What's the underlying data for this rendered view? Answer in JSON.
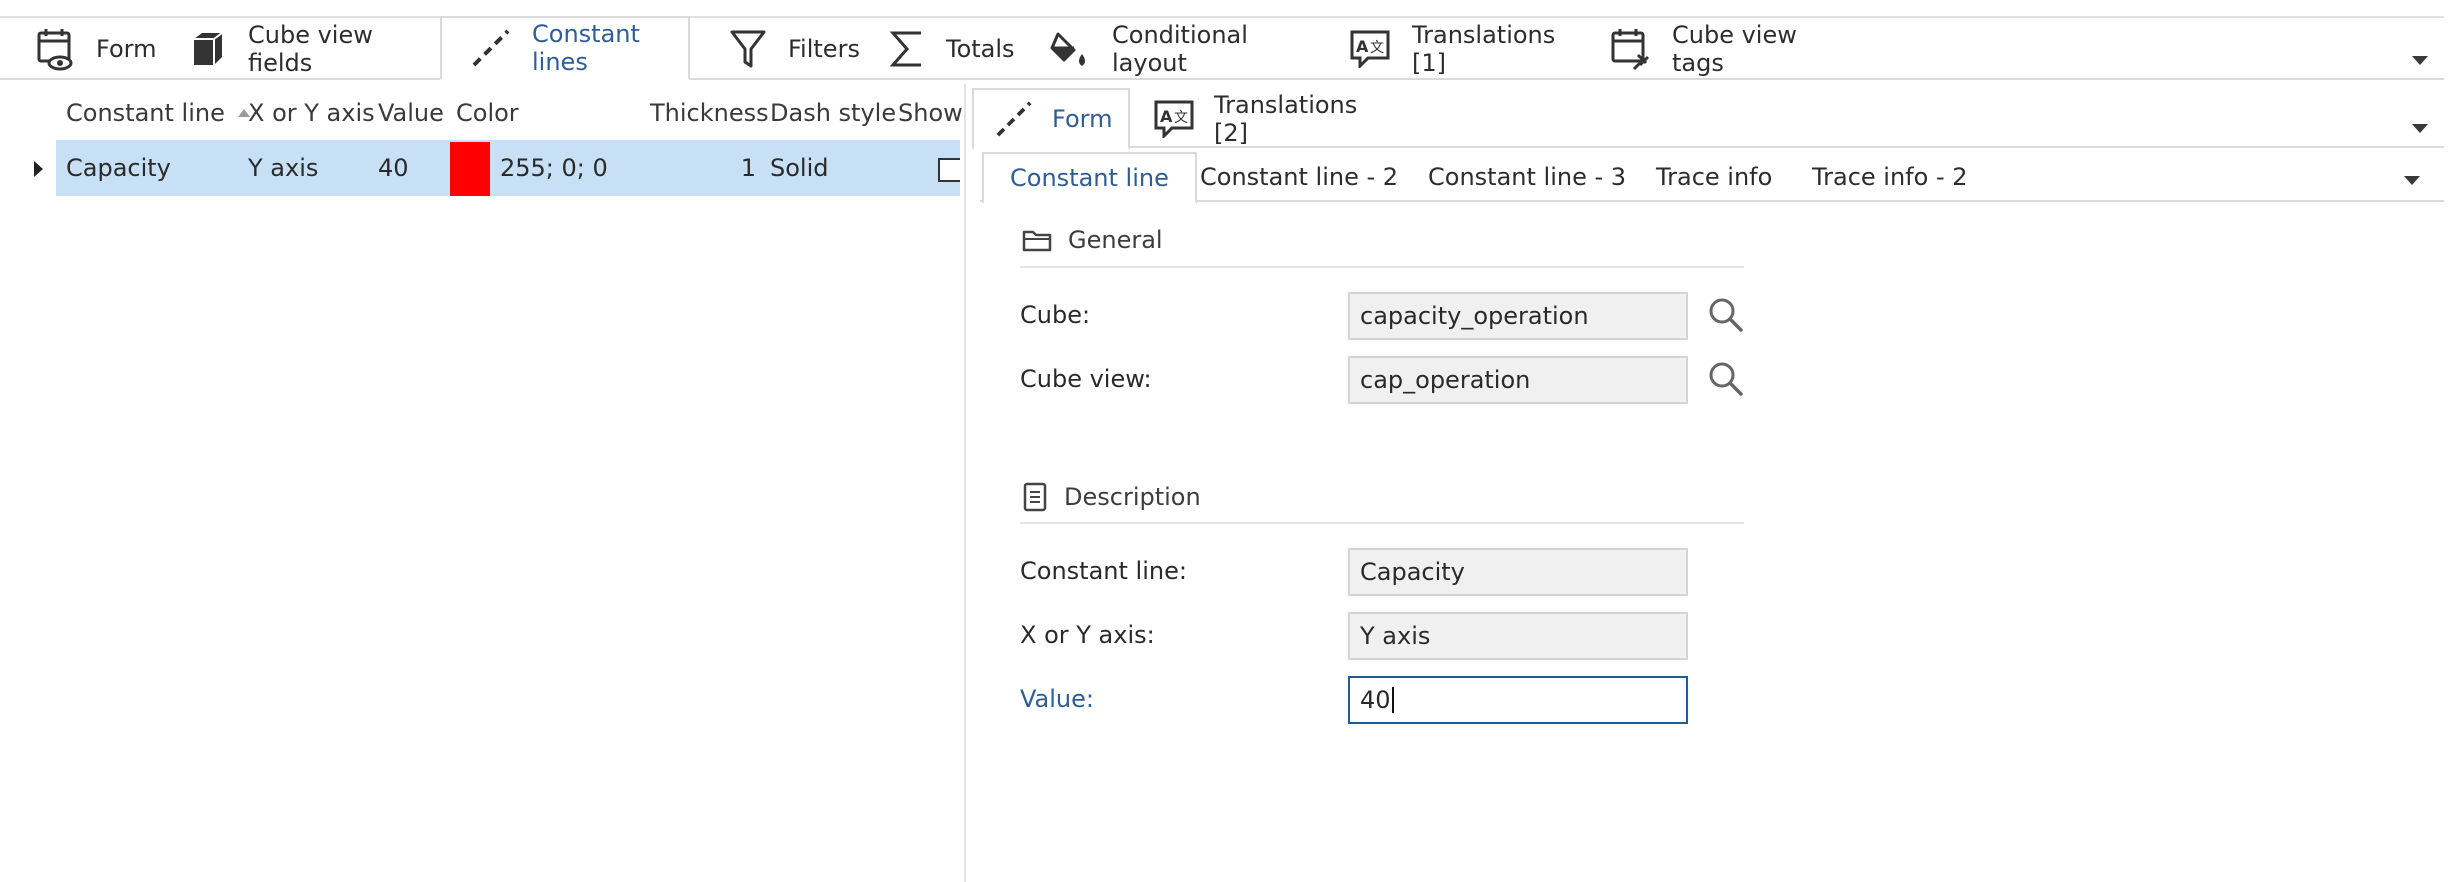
{
  "top_tabs": [
    {
      "label": "Form",
      "icon": "calendar-eye-icon"
    },
    {
      "label": "Cube view fields",
      "icon": "cube-icon"
    },
    {
      "label": "Constant lines",
      "icon": "dashed-line-icon",
      "active": true
    },
    {
      "label": "Filters",
      "icon": "funnel-icon"
    },
    {
      "label": "Totals",
      "icon": "sigma-icon"
    },
    {
      "label": "Conditional layout",
      "icon": "paint-bucket-icon"
    },
    {
      "label": "Translations [1]",
      "icon": "translate-icon"
    },
    {
      "label": "Cube view tags",
      "icon": "calendar-pin-icon"
    }
  ],
  "grid": {
    "columns": [
      "Constant line",
      "X or Y axis",
      "Value",
      "Color",
      "Thickness",
      "Dash style",
      "Show"
    ],
    "sort_column": "Constant line",
    "rows": [
      {
        "constant_line": "Capacity",
        "axis": "Y axis",
        "value": "40",
        "color_swatch": "#ff0000",
        "color": "255; 0; 0",
        "thickness": "1",
        "dash_style": "Solid",
        "show": false
      }
    ]
  },
  "right_tabs": [
    {
      "label": "Form",
      "icon": "dashed-line-icon",
      "active": true
    },
    {
      "label": "Translations [2]",
      "icon": "translate-icon"
    }
  ],
  "sub_tabs": [
    "Constant line",
    "Constant line - 2",
    "Constant line - 3",
    "Trace info",
    "Trace info - 2"
  ],
  "form": {
    "general_title": "General",
    "cube_label": "Cube:",
    "cube_value": "capacity_operation",
    "cube_view_label": "Cube view:",
    "cube_view_value": "cap_operation",
    "description_title": "Description",
    "constant_line_label": "Constant line:",
    "constant_line_value": "Capacity",
    "axis_label": "X or Y axis:",
    "axis_value": "Y axis",
    "value_label": "Value:",
    "value_value": "40"
  },
  "colors": {
    "accent": "#2f5d95",
    "selected_row": "#c7e0f6",
    "focus_border": "#1f5d99"
  }
}
